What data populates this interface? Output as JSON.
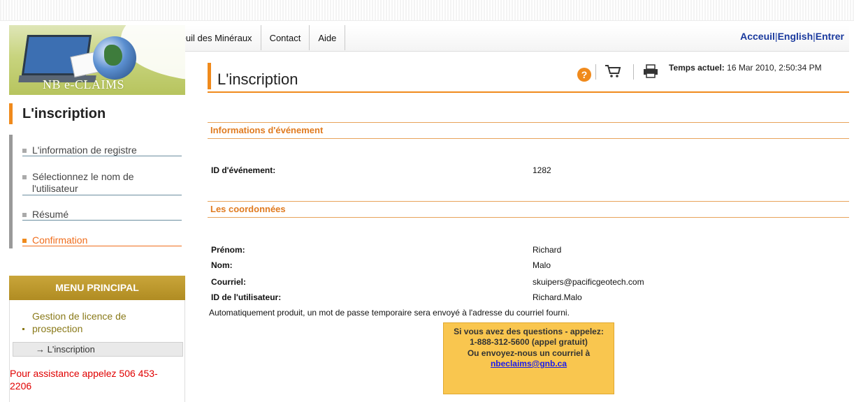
{
  "nav": {
    "links": [
      "Acceuil des Minéraux",
      "Contact",
      "Aide"
    ],
    "right": {
      "home": "Acceuil",
      "english": "English",
      "enter": "Entrer",
      "sep": "|"
    }
  },
  "logo": {
    "text": "NB e-CLAIMS"
  },
  "sidebar": {
    "title": "L'inscription",
    "steps": [
      {
        "label": "L'information de registre",
        "active": false
      },
      {
        "label": "Sélectionnez le nom de l'utilisateur",
        "active": false
      },
      {
        "label": "Résumé",
        "active": false
      },
      {
        "label": "Confirmation",
        "active": true
      }
    ],
    "menu_title": "MENU PRINCIPAL",
    "menu_item": "Gestion de licence de prospection",
    "menu_sub": "→ L'inscription",
    "assistance": "Pour assistance appelez 506 453-2206"
  },
  "header": {
    "title": "L'inscription",
    "help": "?",
    "time_label": "Temps actuel:",
    "time_value": "16 Mar 2010, 2:50:34 PM"
  },
  "event": {
    "heading": "Informations d'événement",
    "id_label": "ID d'événement:",
    "id_value": "1282"
  },
  "contact": {
    "heading": "Les coordonnées",
    "rows": [
      {
        "label": "Prénom:",
        "value": "Richard"
      },
      {
        "label": "Nom:",
        "value": "Malo"
      },
      {
        "label": "Courriel:",
        "value": "skuipers@pacificgeotech.com"
      },
      {
        "label": "ID de l'utilisateur:",
        "value": "Richard.Malo"
      }
    ],
    "note": "Automatiquement produit, un mot de passe temporaire sera envoyé à l'adresse du courriel fourni."
  },
  "callout": {
    "line1": "Si vous avez des questions - appelez: 1-888-312-5600 (appel gratuit)",
    "line2": "Ou envoyez-nous un courriel à",
    "email": "nbeclaims@gnb.ca"
  },
  "colors": {
    "accent": "#f08a1c",
    "link": "#1a3a9e",
    "menu": "#b08c22",
    "callout": "#f9c64f"
  }
}
